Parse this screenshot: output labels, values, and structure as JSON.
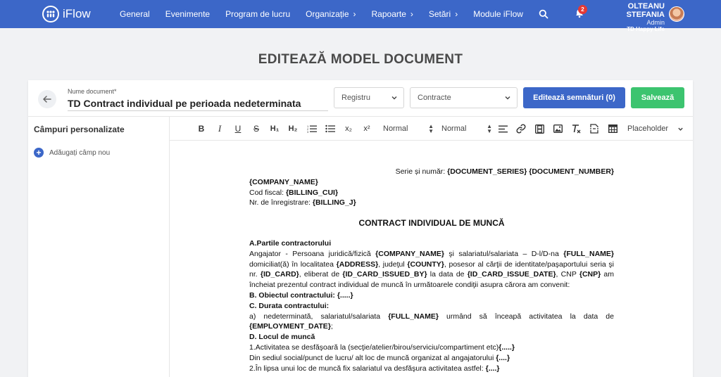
{
  "app": {
    "name": "iFlow"
  },
  "nav": {
    "items": [
      {
        "label": "General",
        "chevron": false
      },
      {
        "label": "Evenimente",
        "chevron": false
      },
      {
        "label": "Program de lucru",
        "chevron": false
      },
      {
        "label": "Organizație",
        "chevron": true
      },
      {
        "label": "Rapoarte",
        "chevron": true
      },
      {
        "label": "Setări",
        "chevron": true
      },
      {
        "label": "Module iFlow",
        "chevron": false
      }
    ]
  },
  "notifications": {
    "count": "2"
  },
  "user": {
    "name": "OLTEANU STEFANIA",
    "role": "Admin",
    "company": "TD Happy Life"
  },
  "page": {
    "title": "EDITEAZĂ MODEL DOCUMENT"
  },
  "form": {
    "docname_label": "Nume document*",
    "docname_value": "TD Contract individual pe perioada nedeterminata",
    "registry_select": "Registru",
    "category_select": "Contracte",
    "edit_signatures": "Editează semnături (0)",
    "save": "Salvează"
  },
  "sidebar": {
    "title": "Câmpuri personalizate",
    "add_field": "Adăugați câmp nou"
  },
  "toolbar": {
    "bold": "B",
    "italic": "I",
    "underline": "U",
    "strike": "S",
    "h1": "H₁",
    "h2": "H₂",
    "subscript": "x₂",
    "superscript": "x²",
    "font_size": "Normal",
    "paragraph": "Normal",
    "placeholder": "Placeholder"
  },
  "document": {
    "series_label": "Serie și număr: ",
    "series_value": "{DOCUMENT_SERIES} {DOCUMENT_NUMBER}",
    "company": "{COMPANY_NAME}",
    "fiscal_label": "Cod fiscal: ",
    "fiscal_value": "{BILLING_CUI}",
    "reg_label": "Nr. de înregistrare: ",
    "reg_value": "{BILLING_J}",
    "title": "CONTRACT INDIVIDUAL DE MUNCĂ",
    "sec_a": "A.Partile contractorului",
    "a1": "Angajator - Persoana juridică/fizică ",
    "a_company": "{COMPANY_NAME}",
    "a2": " şi salariatul/salariata – D-l/D-na ",
    "a_name": "{FULL_NAME}",
    "a3": " domiciliat(ă) în localitatea ",
    "a_address": "{ADDRESS}",
    "a4": ", judeţul ",
    "a_county": "{COUNTY}",
    "a5": ", posesor al cărţii de identitate/paşaportului seria şi nr. ",
    "a_idcard": "{ID_CARD}",
    "a6": ", eliberat de ",
    "a_issued_by": "{ID_CARD_ISSUED_BY}",
    "a7": " la data de ",
    "a_issue_date": "{ID_CARD_ISSUE_DATE}",
    "a8": ", CNP ",
    "a_cnp": "{CNP}",
    "a9": " am încheiat prezentul contract individual de muncă în următoarele condiţii asupra cărora am convenit:",
    "sec_b": "B. Obiectul contractului: {.....}",
    "sec_c": "C. Durata contractului:",
    "c1": "a) nedeterminată, salariatul/salariata ",
    "c_name": "{FULL_NAME}",
    "c2": " urmând să înceapă activitatea la data de ",
    "c_date": "{EMPLOYMENT_DATE}",
    "c3": ";",
    "sec_d": "D. Locul de muncă",
    "d1": "1.Activitatea se desfăşoară la (secţie/atelier/birou/serviciu/compartiment etc)",
    "d1_ph": "{.....}",
    "d2": "Din sediul social/punct de lucru/ alt loc de muncă organizat al angajatorului ",
    "d2_ph": "{....}",
    "d3": "2.În lipsa unui loc de muncă fix salariatul va desfăşura activitatea astfel: ",
    "d3_ph": "{....}"
  },
  "colors": {
    "primary": "#3c67c8",
    "success": "#3cc46f",
    "badge": "#e53935"
  }
}
